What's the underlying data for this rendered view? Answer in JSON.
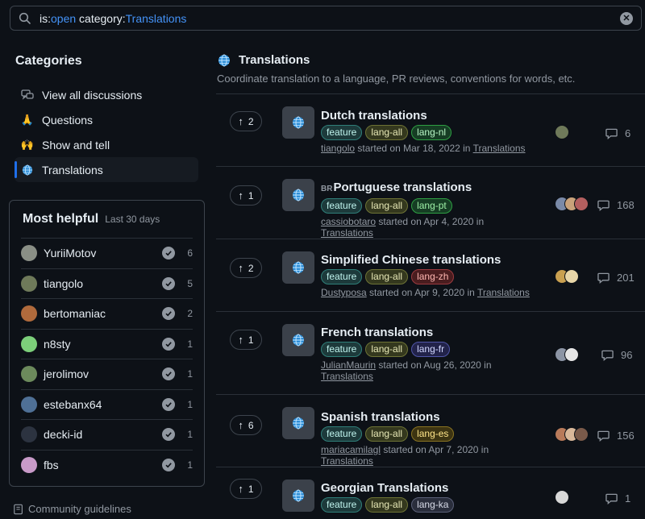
{
  "search": {
    "kw1": "is:",
    "val1": "open",
    "kw2": " category:",
    "val2": "Translations"
  },
  "categories": {
    "title": "Categories",
    "items": [
      {
        "label": "View all discussions",
        "icon": "discussions-icon"
      },
      {
        "label": "Questions",
        "icon": "pray-icon"
      },
      {
        "label": "Show and tell",
        "icon": "raised-hands-icon"
      },
      {
        "label": "Translations",
        "icon": "globe-icon"
      }
    ]
  },
  "helpful": {
    "title": "Most helpful",
    "subtitle": "Last 30 days",
    "users": [
      {
        "name": "YuriiMotov",
        "count": "6",
        "color": "#8a8f86"
      },
      {
        "name": "tiangolo",
        "count": "5",
        "color": "#6f7a5a"
      },
      {
        "name": "bertomaniac",
        "count": "2",
        "color": "#b06a3c"
      },
      {
        "name": "n8sty",
        "count": "1",
        "color": "#7ccf7a"
      },
      {
        "name": "jerolimov",
        "count": "1",
        "color": "#6c8a5c"
      },
      {
        "name": "estebanx64",
        "count": "1",
        "color": "#4f7096"
      },
      {
        "name": "decki-id",
        "count": "1",
        "color": "#2c3340"
      },
      {
        "name": "fbs",
        "count": "1",
        "color": "#c89ac8"
      }
    ]
  },
  "guidelines": "Community guidelines",
  "main": {
    "title": "Translations",
    "description": "Coordinate translation to a language, PR reviews, conventions for words, etc."
  },
  "discussions": [
    {
      "votes": "2",
      "flag": "",
      "title": "Dutch translations",
      "labels": [
        {
          "t": "feature",
          "c": "feature"
        },
        {
          "t": "lang-all",
          "c": "all"
        },
        {
          "t": "lang-nl",
          "c": "nl"
        }
      ],
      "author": "tiangolo",
      "started": "started on Mar 18, 2022 in",
      "cat": "Translations",
      "comments": "6",
      "avatars": [
        "#6f7a5a"
      ]
    },
    {
      "votes": "1",
      "flag": "BR",
      "title": "Portuguese translations",
      "labels": [
        {
          "t": "feature",
          "c": "feature"
        },
        {
          "t": "lang-all",
          "c": "all"
        },
        {
          "t": "lang-pt",
          "c": "pt"
        }
      ],
      "author": "cassiobotaro",
      "started": "started on Apr 4, 2020 in",
      "cat": "Translations",
      "comments": "168",
      "avatars": [
        "#7a8aa8",
        "#c9a27a",
        "#b35f5f"
      ]
    },
    {
      "votes": "2",
      "flag": "",
      "title": "Simplified Chinese translations",
      "labels": [
        {
          "t": "feature",
          "c": "feature"
        },
        {
          "t": "lang-all",
          "c": "all"
        },
        {
          "t": "lang-zh",
          "c": "zh"
        }
      ],
      "author": "Dustyposa",
      "started": "started on Apr 9, 2020 in",
      "cat": "Translations",
      "comments": "201",
      "avatars": [
        "#c9a050",
        "#e8d6a8"
      ]
    },
    {
      "votes": "1",
      "flag": "",
      "title": "French translations",
      "labels": [
        {
          "t": "feature",
          "c": "feature"
        },
        {
          "t": "lang-all",
          "c": "all"
        },
        {
          "t": "lang-fr",
          "c": "fr"
        }
      ],
      "author": "JulianMaurin",
      "started": "started on Aug 26, 2020 in",
      "cat": "Translations",
      "comments": "96",
      "avatars": [
        "#8c95a5",
        "#e6e6e6"
      ]
    },
    {
      "votes": "6",
      "flag": "",
      "title": "Spanish translations",
      "labels": [
        {
          "t": "feature",
          "c": "feature"
        },
        {
          "t": "lang-all",
          "c": "all"
        },
        {
          "t": "lang-es",
          "c": "es"
        }
      ],
      "author": "mariacamilagl",
      "started": "started on Apr 7, 2020 in",
      "cat": "Translations",
      "comments": "156",
      "avatars": [
        "#b87a5a",
        "#d9b89a",
        "#7a5a4a"
      ]
    },
    {
      "votes": "1",
      "flag": "",
      "title": "Georgian Translations",
      "labels": [
        {
          "t": "feature",
          "c": "feature"
        },
        {
          "t": "lang-all",
          "c": "all"
        },
        {
          "t": "lang-ka",
          "c": "ka"
        }
      ],
      "author": "",
      "started": "",
      "cat": "",
      "comments": "1",
      "avatars": [
        "#d8d8d8"
      ]
    }
  ]
}
